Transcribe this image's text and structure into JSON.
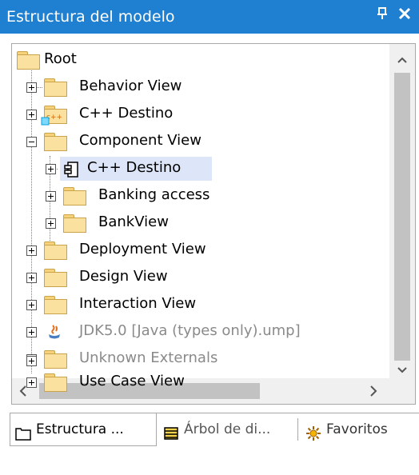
{
  "window": {
    "title": "Estructura del modelo",
    "pin_glyph": "p",
    "close_glyph": "✕"
  },
  "tree": {
    "root_label": "Root",
    "items": [
      {
        "label": "Behavior View",
        "icon": "folder-icon",
        "expander": "plus",
        "grey": false
      },
      {
        "label": "C++ Destino",
        "icon": "cpp-folder-icon",
        "expander": "plus",
        "grey": false
      },
      {
        "label": "Component View",
        "icon": "folder-icon",
        "expander": "minus",
        "grey": false
      },
      {
        "label": "C++ Destino",
        "icon": "component-icon",
        "expander": "plus",
        "grey": false,
        "selected": true
      },
      {
        "label": "Banking access",
        "icon": "folder-icon",
        "expander": "plus",
        "grey": false
      },
      {
        "label": "BankView",
        "icon": "folder-icon",
        "expander": "plus",
        "grey": false
      },
      {
        "label": "Deployment View",
        "icon": "folder-icon",
        "expander": "plus",
        "grey": false
      },
      {
        "label": "Design View",
        "icon": "folder-icon",
        "expander": "plus",
        "grey": false
      },
      {
        "label": "Interaction View",
        "icon": "folder-icon",
        "expander": "plus",
        "grey": false
      },
      {
        "label": "JDK5.0 [Java (types only).ump]",
        "icon": "java-icon",
        "expander": "plus",
        "grey": true
      },
      {
        "label": "Unknown Externals",
        "icon": "folder-icon",
        "expander": "plus",
        "grey": true
      },
      {
        "label": "Use Case View",
        "icon": "folder-icon",
        "expander": "plus",
        "grey": false
      }
    ]
  },
  "tabs": [
    {
      "label": "Estructura ...",
      "icon": "folder-outline-icon",
      "active": true
    },
    {
      "label": "Árbol de di...",
      "icon": "diagram-tree-icon",
      "active": false
    },
    {
      "label": "Favoritos",
      "icon": "star-burst-icon",
      "active": false
    }
  ],
  "colors": {
    "titlebar": "#1f7fd0",
    "selection": "#dde6f8",
    "folder": "#fbe1a0",
    "grey_text": "#8a8a8a"
  }
}
